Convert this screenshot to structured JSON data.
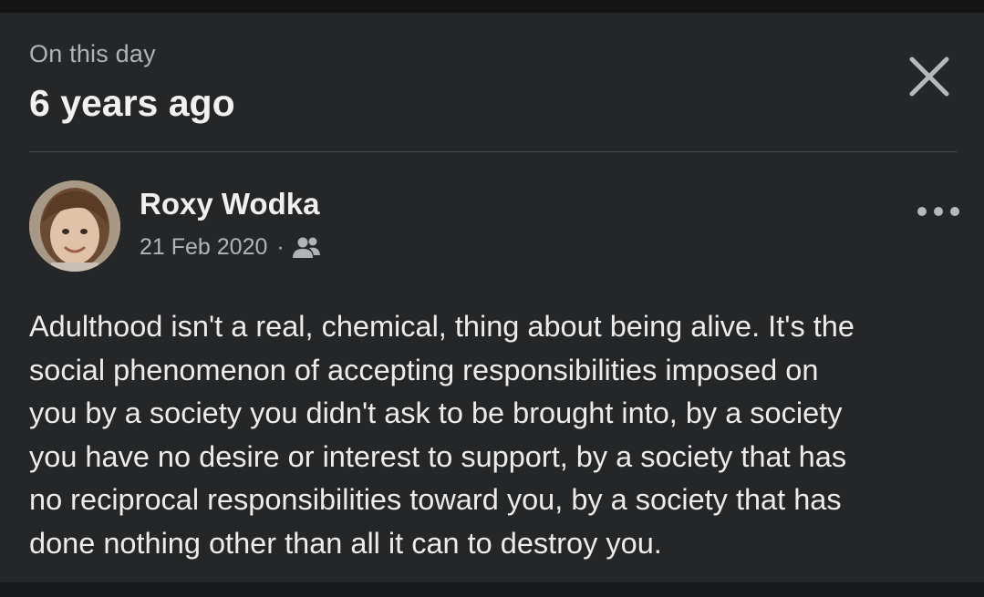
{
  "header": {
    "kicker": "On this day",
    "title": "6 years ago",
    "close_icon": "close-icon"
  },
  "post": {
    "author": "Roxy Wodka",
    "date": "21 Feb 2020",
    "separator": "·",
    "audience_icon": "friends-icon",
    "more_icon": "more-horizontal-icon",
    "text": "Adulthood isn't a real, chemical, thing about being alive. It's the\nsocial phenomenon of accepting responsibilities imposed on\nyou by a society you didn't ask to be brought into, by a society\nyou have no desire or interest to support, by a society that has\nno reciprocal responsibilities toward you, by a society that has\ndone nothing other than all it can to destroy you."
  },
  "colors": {
    "card_background": "#252627",
    "page_background": "#121212",
    "primary_text": "#e4e6eb",
    "secondary_text": "#b0b3b8"
  }
}
